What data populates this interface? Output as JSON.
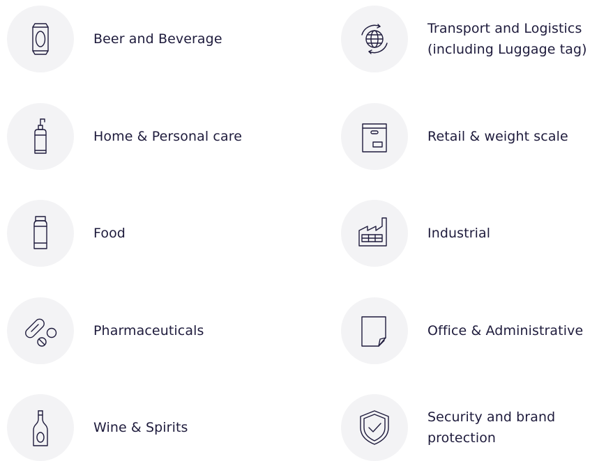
{
  "categories": [
    {
      "label": "Beer and Beverage",
      "icon": "beverage-can-icon"
    },
    {
      "label": "Transport and Logistics",
      "label_line2": "(including Luggage tag)",
      "icon": "globe-cycle-icon"
    },
    {
      "label": "Home & Personal care",
      "icon": "pump-bottle-icon"
    },
    {
      "label": "Retail & weight scale",
      "icon": "package-box-icon"
    },
    {
      "label": "Food",
      "icon": "food-jar-icon"
    },
    {
      "label": "Industrial",
      "icon": "factory-icon"
    },
    {
      "label": "Pharmaceuticals",
      "icon": "pills-icon"
    },
    {
      "label": "Office & Administrative",
      "icon": "document-page-icon"
    },
    {
      "label": "Wine & Spirits",
      "icon": "wine-bottle-icon"
    },
    {
      "label": "Security and brand",
      "label_line2": "protection",
      "icon": "shield-check-icon"
    }
  ],
  "colors": {
    "icon_stroke": "#1e1b3c",
    "circle_background": "#f3f3f5",
    "text": "#1e1b3c"
  }
}
